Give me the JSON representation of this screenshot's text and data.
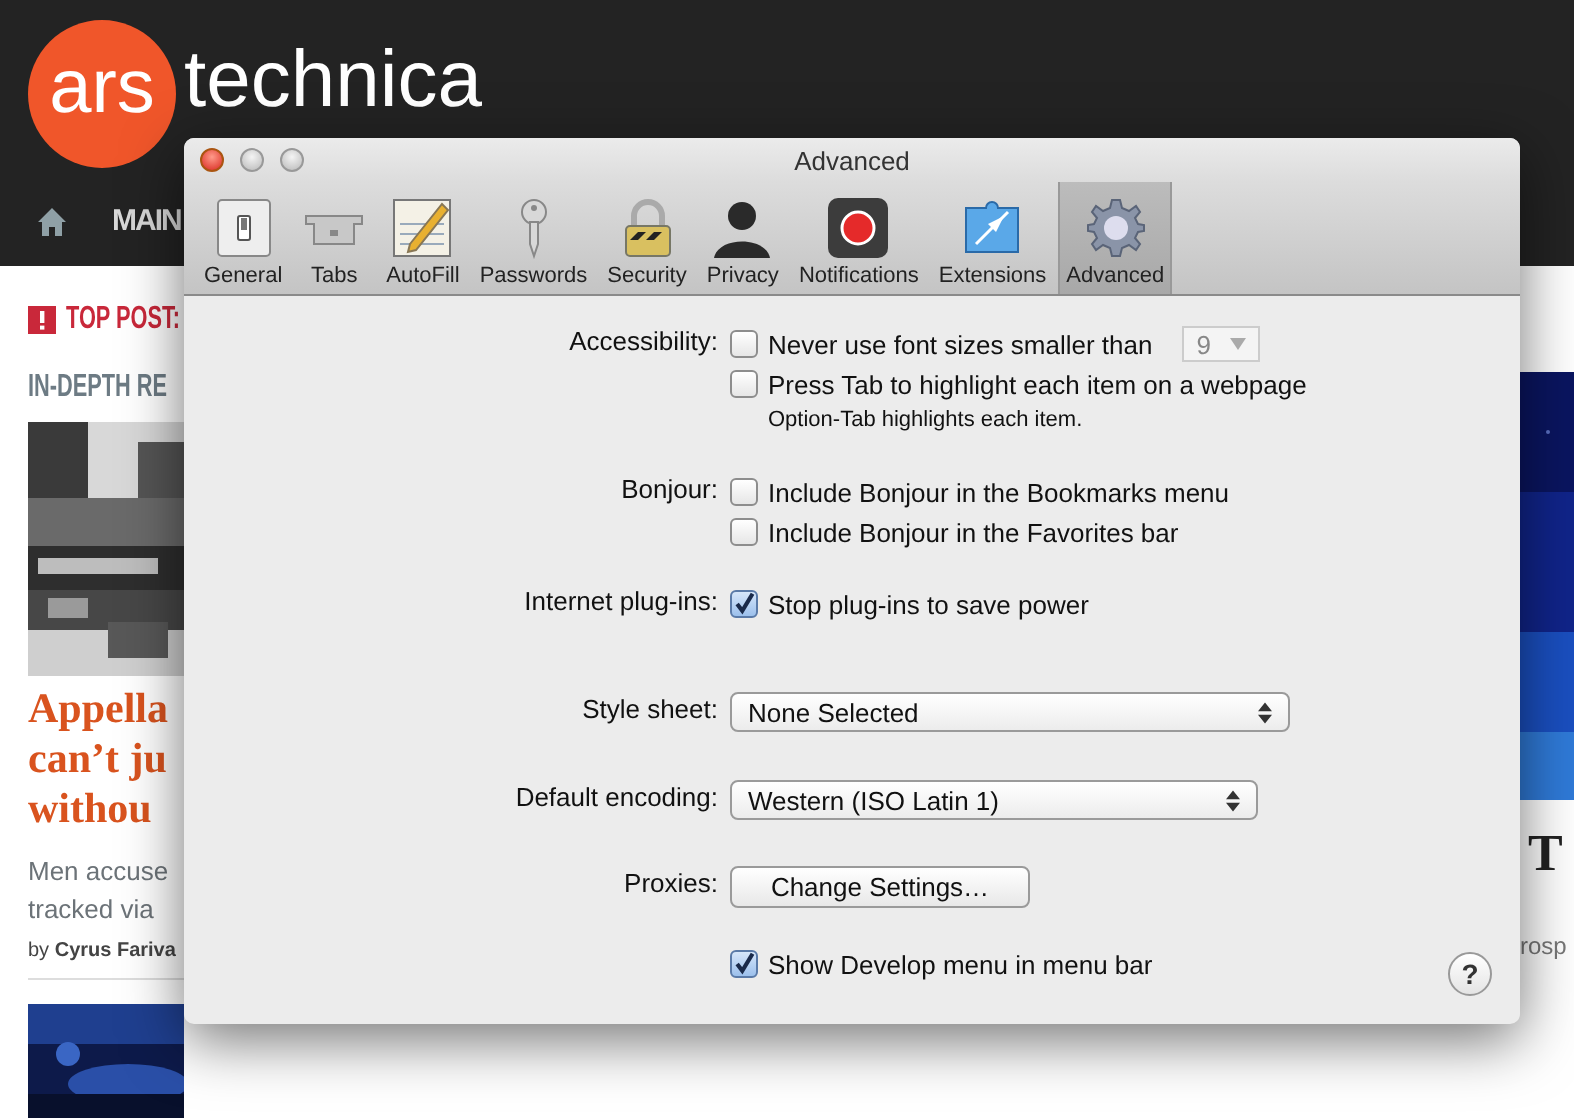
{
  "page": {
    "logo": {
      "badge": "ars",
      "word": "technica"
    },
    "nav": [
      "MAIN"
    ],
    "top_post": "TOP POST:",
    "section": "IN-DEPTH RE",
    "headline": [
      "Appella",
      "can’t ju",
      "withou"
    ],
    "summary": [
      "Men accuse",
      "tracked via"
    ],
    "byline": {
      "prefix": "by",
      "author": "Cyrus Fariva"
    },
    "side_heading": "T",
    "side_text": "rosp"
  },
  "window": {
    "title": "Advanced"
  },
  "toolbar": [
    {
      "label": "General",
      "kind": "general",
      "selected": false
    },
    {
      "label": "Tabs",
      "kind": "tabs",
      "selected": false
    },
    {
      "label": "AutoFill",
      "kind": "autofill",
      "selected": false
    },
    {
      "label": "Passwords",
      "kind": "passwords",
      "selected": false
    },
    {
      "label": "Security",
      "kind": "security",
      "selected": false
    },
    {
      "label": "Privacy",
      "kind": "privacy",
      "selected": false
    },
    {
      "label": "Notifications",
      "kind": "notifications",
      "selected": false
    },
    {
      "label": "Extensions",
      "kind": "extensions",
      "selected": false
    },
    {
      "label": "Advanced",
      "kind": "advanced",
      "selected": true
    }
  ],
  "settings": [
    {
      "kind": "checks",
      "label": "Accessibility:",
      "options": [
        {
          "text": "Never use font sizes smaller than",
          "checked": false,
          "select": {
            "value": "9",
            "disabled": true
          }
        },
        {
          "text": "Press Tab to highlight each item on a webpage",
          "checked": false,
          "note": "Option-Tab highlights each item."
        }
      ]
    },
    {
      "kind": "checks",
      "label": "Bonjour:",
      "options": [
        {
          "text": "Include Bonjour in the Bookmarks menu",
          "checked": false
        },
        {
          "text": "Include Bonjour in the Favorites bar",
          "checked": false
        }
      ]
    },
    {
      "kind": "checks",
      "label": "Internet plug-ins:",
      "options": [
        {
          "text": "Stop plug-ins to save power",
          "checked": true
        }
      ]
    },
    {
      "kind": "popup",
      "label": "Style sheet:",
      "value": "None Selected"
    },
    {
      "kind": "popup",
      "label": "Default encoding:",
      "value": "Western (ISO Latin 1)"
    },
    {
      "kind": "button",
      "label": "Proxies:",
      "value": "Change Settings…"
    },
    {
      "kind": "checks",
      "options": [
        {
          "text": "Show Develop menu in menu bar",
          "checked": true
        }
      ]
    }
  ],
  "help": "?"
}
